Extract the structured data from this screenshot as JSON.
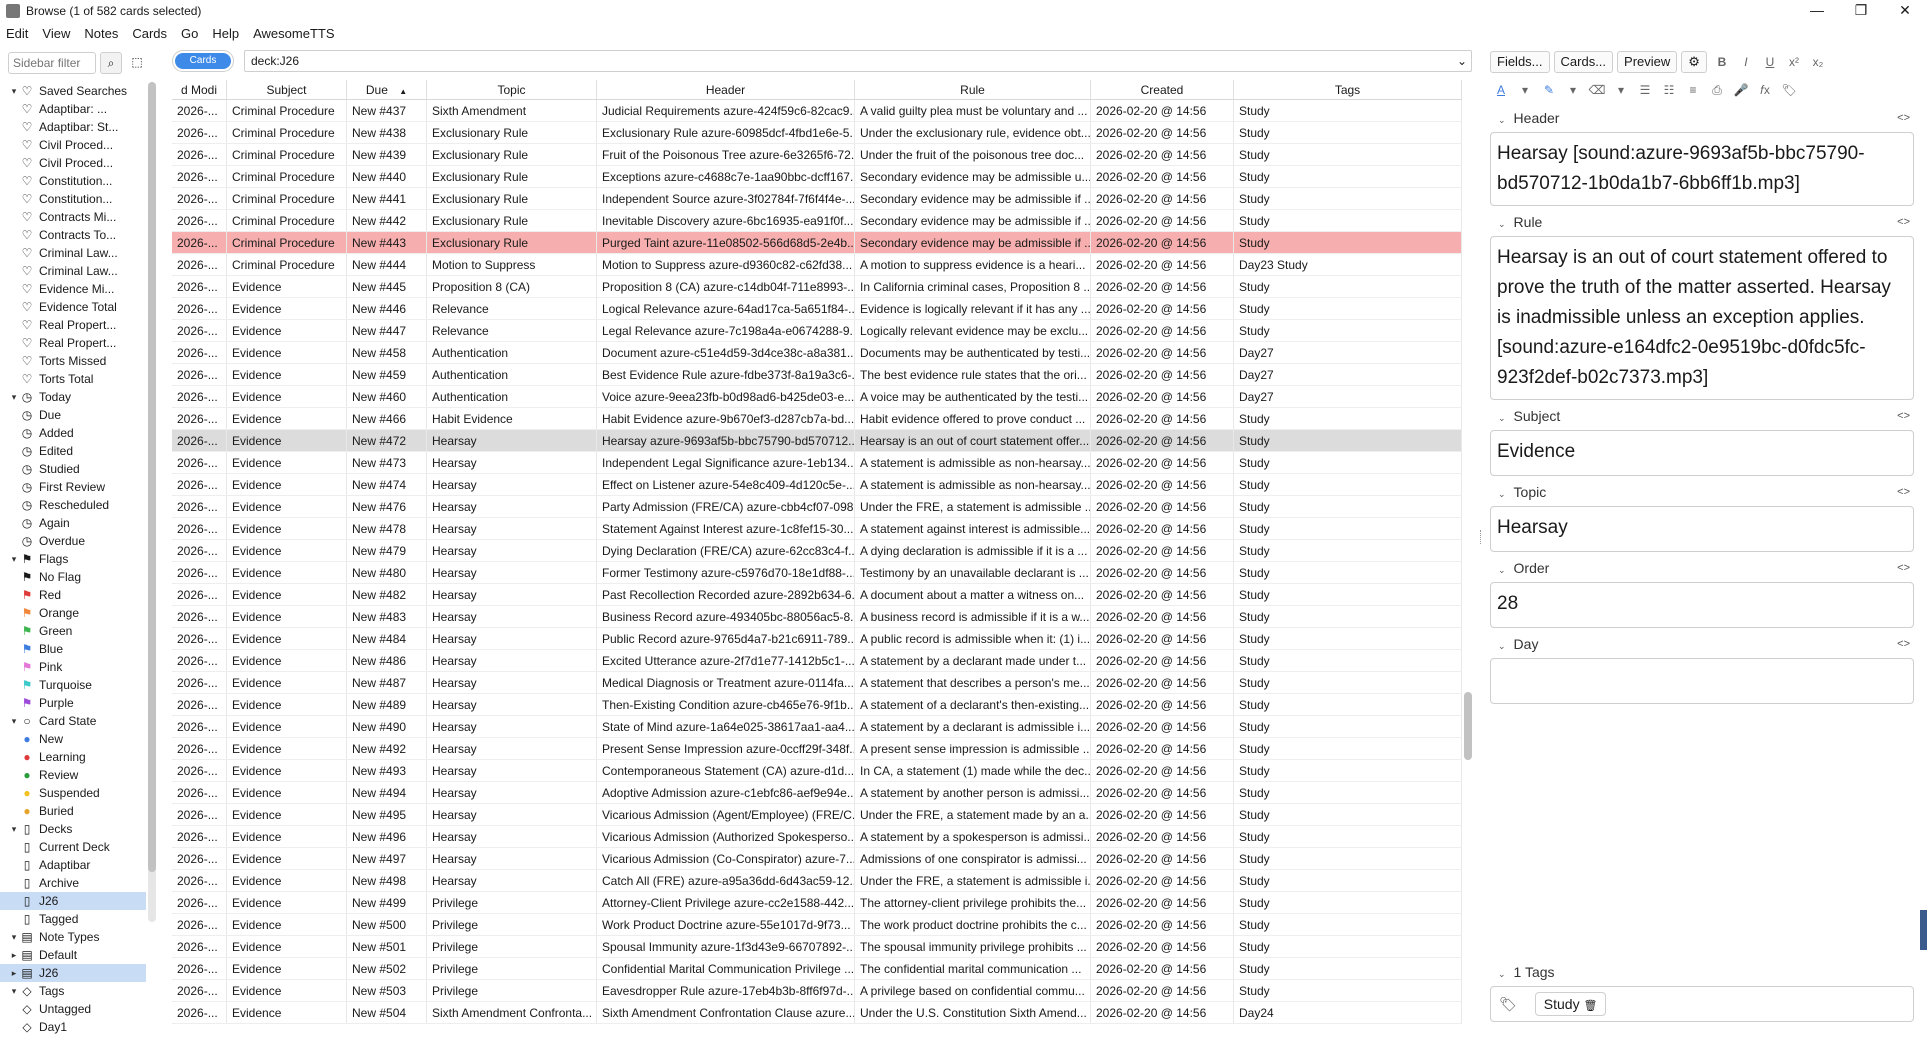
{
  "window": {
    "title": "Browse (1 of 582 cards selected)",
    "minimize": "—",
    "maximize": "❐",
    "close": "✕"
  },
  "menu": [
    "Edit",
    "View",
    "Notes",
    "Cards",
    "Go",
    "Help",
    "AwesomeTTS"
  ],
  "sidebar": {
    "filter_placeholder": "Sidebar filter",
    "items": [
      {
        "arrow": "▾",
        "icon": "♡",
        "label": "Saved Searches"
      },
      {
        "arrow": "",
        "icon": "♡",
        "label": "Adaptibar: ..."
      },
      {
        "arrow": "",
        "icon": "♡",
        "label": "Adaptibar: St..."
      },
      {
        "arrow": "",
        "icon": "♡",
        "label": "Civil Proced..."
      },
      {
        "arrow": "",
        "icon": "♡",
        "label": "Civil Proced..."
      },
      {
        "arrow": "",
        "icon": "♡",
        "label": "Constitution..."
      },
      {
        "arrow": "",
        "icon": "♡",
        "label": "Constitution..."
      },
      {
        "arrow": "",
        "icon": "♡",
        "label": "Contracts Mi..."
      },
      {
        "arrow": "",
        "icon": "♡",
        "label": "Contracts To..."
      },
      {
        "arrow": "",
        "icon": "♡",
        "label": "Criminal Law..."
      },
      {
        "arrow": "",
        "icon": "♡",
        "label": "Criminal Law..."
      },
      {
        "arrow": "",
        "icon": "♡",
        "label": "Evidence Mi..."
      },
      {
        "arrow": "",
        "icon": "♡",
        "label": "Evidence Total"
      },
      {
        "arrow": "",
        "icon": "♡",
        "label": "Real Propert..."
      },
      {
        "arrow": "",
        "icon": "♡",
        "label": "Real Propert..."
      },
      {
        "arrow": "",
        "icon": "♡",
        "label": "Torts Missed"
      },
      {
        "arrow": "",
        "icon": "♡",
        "label": "Torts Total"
      },
      {
        "arrow": "▾",
        "icon": "◷",
        "label": "Today"
      },
      {
        "arrow": "",
        "icon": "◷",
        "label": "Due"
      },
      {
        "arrow": "",
        "icon": "◷",
        "label": "Added"
      },
      {
        "arrow": "",
        "icon": "◷",
        "label": "Edited"
      },
      {
        "arrow": "",
        "icon": "◷",
        "label": "Studied"
      },
      {
        "arrow": "",
        "icon": "◷",
        "label": "First Review"
      },
      {
        "arrow": "",
        "icon": "◷",
        "label": "Rescheduled"
      },
      {
        "arrow": "",
        "icon": "◷",
        "label": "Again"
      },
      {
        "arrow": "",
        "icon": "◷",
        "label": "Overdue"
      },
      {
        "arrow": "▾",
        "icon": "⚑",
        "label": "Flags"
      },
      {
        "arrow": "",
        "icon": "⚑",
        "label": "No Flag"
      },
      {
        "arrow": "",
        "icon": "⚑",
        "label": "Red"
      },
      {
        "arrow": "",
        "icon": "⚑",
        "label": "Orange"
      },
      {
        "arrow": "",
        "icon": "⚑",
        "label": "Green"
      },
      {
        "arrow": "",
        "icon": "⚑",
        "label": "Blue"
      },
      {
        "arrow": "",
        "icon": "⚑",
        "label": "Pink"
      },
      {
        "arrow": "",
        "icon": "⚑",
        "label": "Turquoise"
      },
      {
        "arrow": "",
        "icon": "⚑",
        "label": "Purple"
      },
      {
        "arrow": "▾",
        "icon": "○",
        "label": "Card State"
      },
      {
        "arrow": "",
        "icon": "●",
        "label": "New"
      },
      {
        "arrow": "",
        "icon": "●",
        "label": "Learning"
      },
      {
        "arrow": "",
        "icon": "●",
        "label": "Review"
      },
      {
        "arrow": "",
        "icon": "●",
        "label": "Suspended"
      },
      {
        "arrow": "",
        "icon": "●",
        "label": "Buried"
      },
      {
        "arrow": "▾",
        "icon": "▯",
        "label": "Decks"
      },
      {
        "arrow": "",
        "icon": "▯",
        "label": "Current Deck"
      },
      {
        "arrow": "",
        "icon": "▯",
        "label": "Adaptibar"
      },
      {
        "arrow": "",
        "icon": "▯",
        "label": "Archive"
      },
      {
        "arrow": "",
        "icon": "▯",
        "label": "J26"
      },
      {
        "arrow": "",
        "icon": "▯",
        "label": "Tagged"
      },
      {
        "arrow": "▾",
        "icon": "▤",
        "label": "Note Types"
      },
      {
        "arrow": "▸",
        "icon": "▤",
        "label": "Default"
      },
      {
        "arrow": "▸",
        "icon": "▤",
        "label": "J26"
      },
      {
        "arrow": "▾",
        "icon": "◇",
        "label": "Tags"
      },
      {
        "arrow": "",
        "icon": "◇",
        "label": "Untagged"
      },
      {
        "arrow": "",
        "icon": "◇",
        "label": "Day1"
      }
    ],
    "icon_colors": {
      "Red": "#e03b3b",
      "Orange": "#f0873a",
      "Green": "#3fb54f",
      "Blue": "#3d7de0",
      "Pink": "#e477d8",
      "Turquoise": "#3cc9c9",
      "Purple": "#9d4ad8",
      "New": "#3d7de0",
      "Learning": "#e03b3b",
      "Review": "#2a9c3b",
      "Suspended": "#f2c01f",
      "Buried": "#e6a32b"
    },
    "selected": "J26"
  },
  "toggle_label": "Cards",
  "search_query": "deck:J26",
  "table": {
    "headers": [
      "d Modi",
      "Subject",
      "Due",
      "Topic",
      "Header",
      "Rule",
      "Created",
      "Tags"
    ],
    "sort_indicator": "▲",
    "rows": [
      [
        "2026-...",
        "Criminal Procedure",
        "New #437",
        "Sixth Amendment",
        "Judicial Requirements azure-424f59c6-82cac9...",
        "A valid guilty plea must be voluntary and ...",
        "2026-02-20 @ 14:56",
        "Study"
      ],
      [
        "2026-...",
        "Criminal Procedure",
        "New #438",
        "Exclusionary Rule",
        "Exclusionary Rule azure-60985dcf-4fbd1e6e-5...",
        "Under the exclusionary rule, evidence obt...",
        "2026-02-20 @ 14:56",
        "Study"
      ],
      [
        "2026-...",
        "Criminal Procedure",
        "New #439",
        "Exclusionary Rule",
        "Fruit of the Poisonous Tree azure-6e3265f6-72...",
        "Under the fruit of the poisonous tree doc...",
        "2026-02-20 @ 14:56",
        "Study"
      ],
      [
        "2026-...",
        "Criminal Procedure",
        "New #440",
        "Exclusionary Rule",
        "Exceptions azure-c4688c7e-1aa90bbc-dcff167...",
        "Secondary evidence may be admissible u...",
        "2026-02-20 @ 14:56",
        "Study"
      ],
      [
        "2026-...",
        "Criminal Procedure",
        "New #441",
        "Exclusionary Rule",
        "Independent Source azure-3f02784f-7f6f4f4e-...",
        "Secondary evidence may be admissible if ...",
        "2026-02-20 @ 14:56",
        "Study"
      ],
      [
        "2026-...",
        "Criminal Procedure",
        "New #442",
        "Exclusionary Rule",
        "Inevitable Discovery azure-6bc16935-ea91f0f...",
        "Secondary evidence may be admissible if ...",
        "2026-02-20 @ 14:56",
        "Study"
      ],
      [
        "2026-...",
        "Criminal Procedure",
        "New #443",
        "Exclusionary Rule",
        "Purged Taint azure-11e08502-566d68d5-2e4b...",
        "Secondary evidence may be admissible if ...",
        "2026-02-20 @ 14:56",
        "Study"
      ],
      [
        "2026-...",
        "Criminal Procedure",
        "New #444",
        "Motion to Suppress",
        "Motion to Suppress azure-d9360c82-c62fd38...",
        "A motion to suppress evidence is a heari...",
        "2026-02-20 @ 14:56",
        "Day23 Study"
      ],
      [
        "2026-...",
        "Evidence",
        "New #445",
        "Proposition 8 (CA)",
        "Proposition 8 (CA) azure-c14db04f-711e8993-...",
        "In California criminal cases, Proposition 8 ...",
        "2026-02-20 @ 14:56",
        "Study"
      ],
      [
        "2026-...",
        "Evidence",
        "New #446",
        "Relevance",
        "Logical Relevance azure-64ad17ca-5a651f84-...",
        "Evidence is logically relevant if it has any ...",
        "2026-02-20 @ 14:56",
        "Study"
      ],
      [
        "2026-...",
        "Evidence",
        "New #447",
        "Relevance",
        "Legal Relevance azure-7c198a4a-e0674288-9...",
        "Logically relevant evidence may be exclu...",
        "2026-02-20 @ 14:56",
        "Study"
      ],
      [
        "2026-...",
        "Evidence",
        "New #458",
        "Authentication",
        "Document azure-c51e4d59-3d4ce38c-a8a381...",
        "Documents may be authenticated by testi...",
        "2026-02-20 @ 14:56",
        "Day27"
      ],
      [
        "2026-...",
        "Evidence",
        "New #459",
        "Authentication",
        "Best Evidence Rule azure-fdbe373f-8a19a3c6-...",
        "The best evidence rule states that the ori...",
        "2026-02-20 @ 14:56",
        "Day27"
      ],
      [
        "2026-...",
        "Evidence",
        "New #460",
        "Authentication",
        "Voice azure-9eea23fb-b0d98ad6-b425de03-e...",
        "A voice may be authenticated by the testi...",
        "2026-02-20 @ 14:56",
        "Day27"
      ],
      [
        "2026-...",
        "Evidence",
        "New #466",
        "Habit Evidence",
        "Habit Evidence azure-9b670ef3-d287cb7a-bd...",
        "Habit evidence offered to prove conduct ...",
        "2026-02-20 @ 14:56",
        "Study"
      ],
      [
        "2026-...",
        "Evidence",
        "New #472",
        "Hearsay",
        "Hearsay azure-9693af5b-bbc75790-bd570712...",
        "Hearsay is an out of court statement offer...",
        "2026-02-20 @ 14:56",
        "Study"
      ],
      [
        "2026-...",
        "Evidence",
        "New #473",
        "Hearsay",
        "Independent Legal Significance azure-1eb134...",
        "A statement is admissible as non-hearsay...",
        "2026-02-20 @ 14:56",
        "Study"
      ],
      [
        "2026-...",
        "Evidence",
        "New #474",
        "Hearsay",
        "Effect on Listener azure-54e8c409-4d120c5e-...",
        "A statement is admissible as non-hearsay...",
        "2026-02-20 @ 14:56",
        "Study"
      ],
      [
        "2026-...",
        "Evidence",
        "New #476",
        "Hearsay",
        "Party Admission (FRE/CA) azure-cbb4cf07-098...",
        "Under the FRE, a statement is admissible ...",
        "2026-02-20 @ 14:56",
        "Study"
      ],
      [
        "2026-...",
        "Evidence",
        "New #478",
        "Hearsay",
        "Statement Against Interest azure-1c8fef15-30...",
        "A statement against interest is admissible...",
        "2026-02-20 @ 14:56",
        "Study"
      ],
      [
        "2026-...",
        "Evidence",
        "New #479",
        "Hearsay",
        "Dying Declaration (FRE/CA) azure-62cc83c4-f...",
        "A dying declaration is admissible if it is a ...",
        "2026-02-20 @ 14:56",
        "Study"
      ],
      [
        "2026-...",
        "Evidence",
        "New #480",
        "Hearsay",
        "Former Testimony azure-c5976d70-18e1df88-...",
        "Testimony by an unavailable declarant is ...",
        "2026-02-20 @ 14:56",
        "Study"
      ],
      [
        "2026-...",
        "Evidence",
        "New #482",
        "Hearsay",
        "Past Recollection Recorded azure-2892b634-6...",
        "A document about a matter a witness on...",
        "2026-02-20 @ 14:56",
        "Study"
      ],
      [
        "2026-...",
        "Evidence",
        "New #483",
        "Hearsay",
        "Business Record azure-493405bc-88056ac5-8...",
        "A business record is admissible if it is a w...",
        "2026-02-20 @ 14:56",
        "Study"
      ],
      [
        "2026-...",
        "Evidence",
        "New #484",
        "Hearsay",
        "Public Record azure-9765d4a7-b21c6911-789...",
        "A public record is admissible when it: (1) i...",
        "2026-02-20 @ 14:56",
        "Study"
      ],
      [
        "2026-...",
        "Evidence",
        "New #486",
        "Hearsay",
        "Excited Utterance azure-2f7d1e77-1412b5c1-...",
        "A statement by a declarant made under t...",
        "2026-02-20 @ 14:56",
        "Study"
      ],
      [
        "2026-...",
        "Evidence",
        "New #487",
        "Hearsay",
        "Medical Diagnosis or Treatment azure-0114fa...",
        "A statement that describes a person's me...",
        "2026-02-20 @ 14:56",
        "Study"
      ],
      [
        "2026-...",
        "Evidence",
        "New #489",
        "Hearsay",
        "Then-Existing Condition azure-cb465e76-9f1b...",
        "A statement of a declarant's then-existing...",
        "2026-02-20 @ 14:56",
        "Study"
      ],
      [
        "2026-...",
        "Evidence",
        "New #490",
        "Hearsay",
        "State of Mind azure-1a64e025-38617aa1-aa4...",
        "A statement by a declarant is admissible i...",
        "2026-02-20 @ 14:56",
        "Study"
      ],
      [
        "2026-...",
        "Evidence",
        "New #492",
        "Hearsay",
        "Present Sense Impression azure-0ccff29f-348f...",
        "A present sense impression is admissible ...",
        "2026-02-20 @ 14:56",
        "Study"
      ],
      [
        "2026-...",
        "Evidence",
        "New #493",
        "Hearsay",
        "Contemporaneous Statement (CA) azure-d1d...",
        "In CA, a statement (1) made while the dec...",
        "2026-02-20 @ 14:56",
        "Study"
      ],
      [
        "2026-...",
        "Evidence",
        "New #494",
        "Hearsay",
        "Adoptive Admission azure-c1ebfc86-aef9e94e...",
        "A statement by another person is admissi...",
        "2026-02-20 @ 14:56",
        "Study"
      ],
      [
        "2026-...",
        "Evidence",
        "New #495",
        "Hearsay",
        "Vicarious Admission (Agent/Employee) (FRE/C...",
        "Under the FRE, a statement made by an a...",
        "2026-02-20 @ 14:56",
        "Study"
      ],
      [
        "2026-...",
        "Evidence",
        "New #496",
        "Hearsay",
        "Vicarious Admission (Authorized Spokesperso...",
        "A statement by a spokesperson is admissi...",
        "2026-02-20 @ 14:56",
        "Study"
      ],
      [
        "2026-...",
        "Evidence",
        "New #497",
        "Hearsay",
        "Vicarious Admission (Co-Conspirator) azure-7...",
        "Admissions of one conspirator is admissi...",
        "2026-02-20 @ 14:56",
        "Study"
      ],
      [
        "2026-...",
        "Evidence",
        "New #498",
        "Hearsay",
        "Catch All (FRE) azure-a95a36dd-6d43ac59-12...",
        "Under the FRE, a statement is admissible i...",
        "2026-02-20 @ 14:56",
        "Study"
      ],
      [
        "2026-...",
        "Evidence",
        "New #499",
        "Privilege",
        "Attorney-Client Privilege azure-cc2e1588-442...",
        "The attorney-client privilege prohibits the...",
        "2026-02-20 @ 14:56",
        "Study"
      ],
      [
        "2026-...",
        "Evidence",
        "New #500",
        "Privilege",
        "Work Product Doctrine azure-55e1017d-9f73...",
        "The work product doctrine prohibits the c...",
        "2026-02-20 @ 14:56",
        "Study"
      ],
      [
        "2026-...",
        "Evidence",
        "New #501",
        "Privilege",
        "Spousal Immunity azure-1f3d43e9-66707892-...",
        "The spousal immunity privilege prohibits ...",
        "2026-02-20 @ 14:56",
        "Study"
      ],
      [
        "2026-...",
        "Evidence",
        "New #502",
        "Privilege",
        "Confidential Marital Communication Privilege ...",
        "The confidential marital communication ...",
        "2026-02-20 @ 14:56",
        "Study"
      ],
      [
        "2026-...",
        "Evidence",
        "New #503",
        "Privilege",
        "Eavesdropper Rule azure-17eb4b3b-8ff6f97d-...",
        "A privilege based on confidential commu...",
        "2026-02-20 @ 14:56",
        "Study"
      ],
      [
        "2026-...",
        "Evidence",
        "New #504",
        "Sixth Amendment Confronta...",
        "Sixth Amendment Confrontation Clause azure...",
        "Under the U.S. Constitution Sixth Amend...",
        "2026-02-20 @ 14:56",
        "Day24"
      ]
    ],
    "marked_row": 6,
    "current_row": 15
  },
  "editor": {
    "buttons": [
      "Fields...",
      "Cards...",
      "Preview"
    ],
    "format_icons": [
      "B",
      "I",
      "U",
      "x²",
      "x₂"
    ],
    "row2_icons": [
      "A",
      "▾",
      "✎",
      "▾",
      "⌫",
      "▾",
      "☰",
      "☷",
      "≡",
      "⎙",
      "🎤",
      "𝑓x",
      "🏷"
    ],
    "code_toggle": "<>",
    "fields": [
      {
        "name": "Header",
        "value": "Hearsay [sound:azure-9693af5b-bbc75790-bd570712-1b0da1b7-6bb6ff1b.mp3]"
      },
      {
        "name": "Rule",
        "value": "Hearsay is an out of court statement offered to prove the truth of the matter asserted. Hearsay is inadmissible unless an exception applies. [sound:azure-e164dfc2-0e9519bc-d0fdc5fc-923f2def-b02c7373.mp3]"
      },
      {
        "name": "Subject",
        "value": "Evidence"
      },
      {
        "name": "Topic",
        "value": "Hearsay"
      },
      {
        "name": "Order",
        "value": "28"
      },
      {
        "name": "Day",
        "value": ""
      }
    ],
    "tags_label": "1 Tags",
    "tags": [
      "Study"
    ],
    "tag_delete_icon": "🗑"
  },
  "colors": {
    "marked_row_bg": "#f7aeae",
    "current_row_bg": "#dcdcdc",
    "accent": "#3d8ae8"
  }
}
